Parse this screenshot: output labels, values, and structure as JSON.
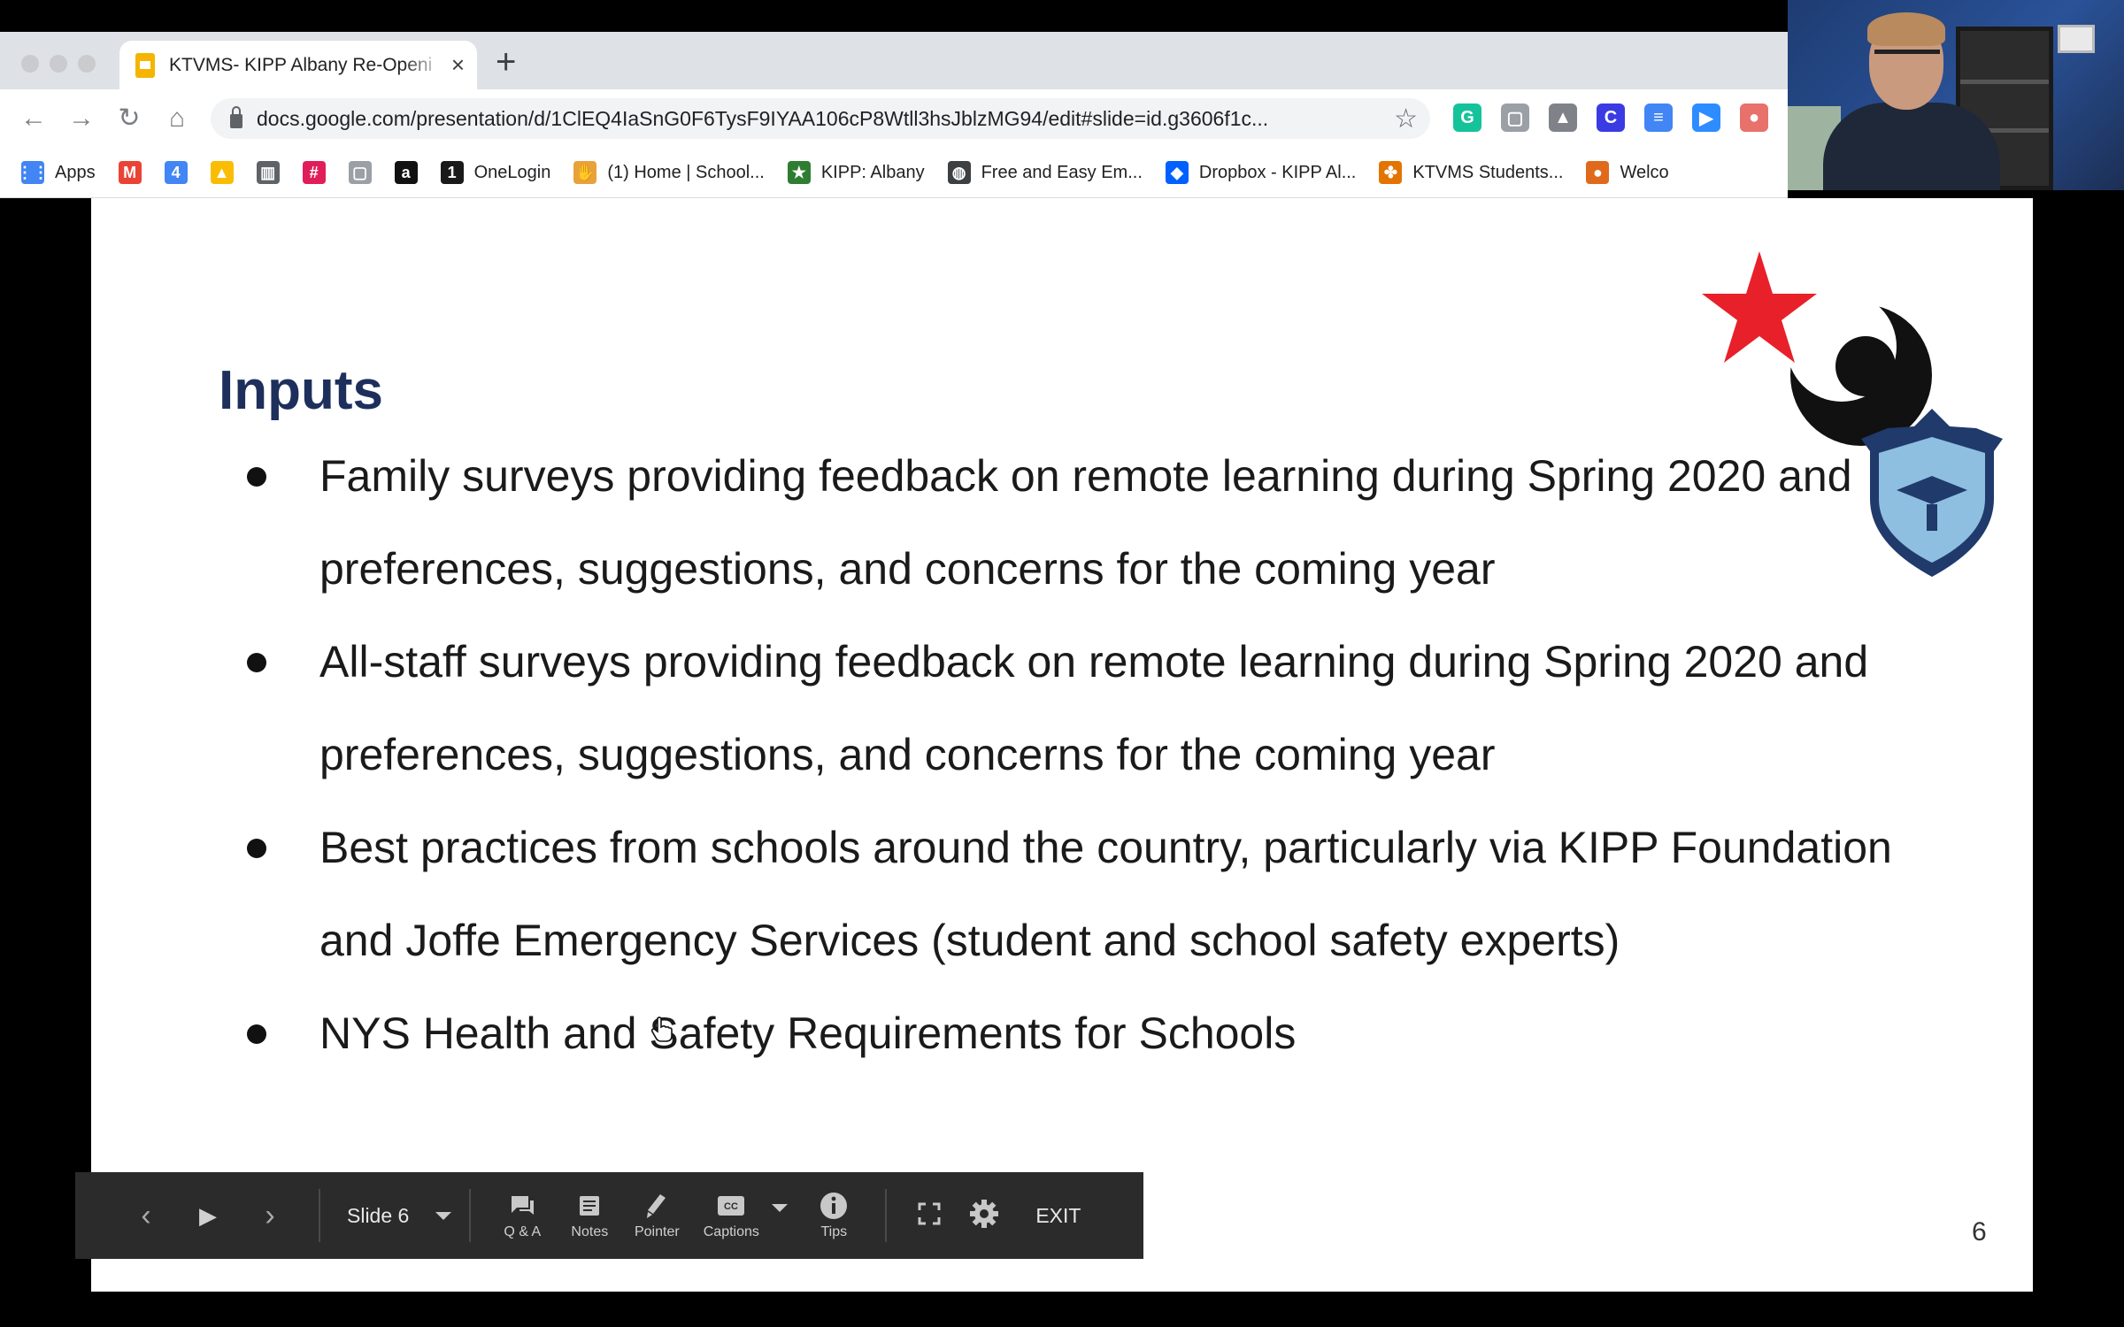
{
  "browser": {
    "tab_title": "KTVMS- KIPP Albany Re-Openi",
    "tab_close": "×",
    "new_tab": "+",
    "url": "docs.google.com/presentation/d/1ClEQ4IaSnG0F6TysF9IYAA106cP8Wtll3hsJblzMG94/edit#slide=id.g3606f1c...",
    "nav": {
      "back": "←",
      "forward": "→",
      "reload": "↻",
      "home": "⌂"
    },
    "star": "☆",
    "extensions": [
      {
        "icon": "grammarly-icon",
        "label": "G",
        "color": "#15c39a"
      },
      {
        "icon": "page-icon",
        "label": "▢",
        "color": "#9aa0a6"
      },
      {
        "icon": "drive-icon",
        "label": "▲",
        "color": "#7f8389"
      },
      {
        "icon": "c-icon",
        "label": "C",
        "color": "#3b3be3"
      },
      {
        "icon": "docs-icon",
        "label": "≡",
        "color": "#4285f4"
      },
      {
        "icon": "zoom-icon",
        "label": "▶",
        "color": "#2d8cff"
      },
      {
        "icon": "extension-icon",
        "label": "●",
        "color": "#e8716b"
      }
    ],
    "bookmarks": [
      {
        "label": "Apps",
        "icon": "apps-grid-icon",
        "color": "#4285f4",
        "glyph": "⋮⋮"
      },
      {
        "label": "",
        "icon": "gmail-icon",
        "color": "#ea4335",
        "glyph": "M"
      },
      {
        "label": "",
        "icon": "calendar-icon",
        "color": "#4285f4",
        "glyph": "4"
      },
      {
        "label": "",
        "icon": "drive-icon",
        "color": "#fbbc04",
        "glyph": "▲"
      },
      {
        "label": "",
        "icon": "trello-icon",
        "color": "#5f6368",
        "glyph": "▥"
      },
      {
        "label": "",
        "icon": "slack-icon",
        "color": "#e01e5a",
        "glyph": "#"
      },
      {
        "label": "",
        "icon": "page-icon",
        "color": "#9aa0a6",
        "glyph": "▢"
      },
      {
        "label": "",
        "icon": "amazon-icon",
        "color": "#111111",
        "glyph": "a"
      },
      {
        "label": "OneLogin",
        "icon": "onelogin-icon",
        "color": "#1a1a1a",
        "glyph": "1"
      },
      {
        "label": "(1) Home | School...",
        "icon": "hand-icon",
        "color": "#e8a23a",
        "glyph": "✋"
      },
      {
        "label": "KIPP: Albany",
        "icon": "kipp-star-icon",
        "color": "#2e7d32",
        "glyph": "★"
      },
      {
        "label": "Free and Easy Em...",
        "icon": "globe-icon",
        "color": "#3c4043",
        "glyph": "◍"
      },
      {
        "label": "Dropbox - KIPP Al...",
        "icon": "dropbox-icon",
        "color": "#0061ff",
        "glyph": "◆"
      },
      {
        "label": "KTVMS Students...",
        "icon": "pinwheel-icon",
        "color": "#e37400",
        "glyph": "✤"
      },
      {
        "label": "Welco",
        "icon": "person-icon",
        "color": "#e06a1b",
        "glyph": "●"
      }
    ]
  },
  "slide": {
    "title": "Inputs",
    "bullets": [
      "Family surveys providing feedback on remote learning during Spring 2020 and preferences, suggestions, and concerns for the coming year",
      "All-staff surveys providing feedback on remote learning during Spring 2020 and preferences, suggestions, and concerns for the coming year",
      "Best practices from schools around the country, particularly via KIPP Foundation and Joffe Emergency Services (student and school safety experts)",
      "NYS Health and Safety Requirements for Schools"
    ],
    "number": "6",
    "colors": {
      "title": "#1f2f5c",
      "logo_star": "#e8202a",
      "shield": "#8fbfe0"
    }
  },
  "presenter": {
    "prev": "‹",
    "play": "▶",
    "next": "›",
    "slide_label": "Slide 6",
    "tools": [
      {
        "icon": "qa-icon",
        "label": "Q & A"
      },
      {
        "icon": "notes-icon",
        "label": "Notes"
      },
      {
        "icon": "pointer-icon",
        "label": "Pointer"
      },
      {
        "icon": "captions-icon",
        "label": "Captions"
      },
      {
        "icon": "tips-icon",
        "label": "Tips"
      }
    ],
    "exit": "EXIT"
  }
}
